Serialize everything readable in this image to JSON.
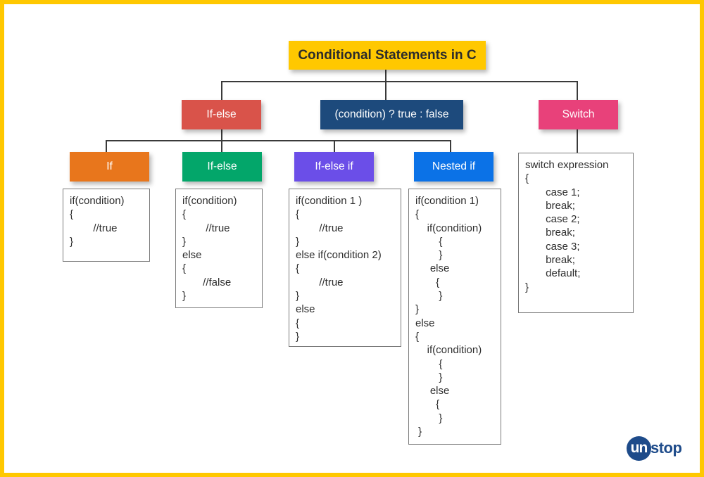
{
  "title": "Conditional Statements in C",
  "colors": {
    "border": "#ffc800",
    "title_bg": "#ffc800",
    "if_else_top": "#d9534a",
    "ternary": "#1d4a7c",
    "switch": "#e8417a",
    "if": "#e8761c",
    "if_else": "#03a66a",
    "if_else_if": "#6b4ee8",
    "nested_if": "#0b72e7"
  },
  "level1": [
    {
      "id": "if-else",
      "label": "If-else"
    },
    {
      "id": "ternary",
      "label": "(condition) ? true : false"
    },
    {
      "id": "switch",
      "label": "Switch"
    }
  ],
  "level2": [
    {
      "id": "if",
      "label": "If"
    },
    {
      "id": "if-else",
      "label": "If-else"
    },
    {
      "id": "if-else-if",
      "label": "If-else if"
    },
    {
      "id": "nested-if",
      "label": "Nested if"
    }
  ],
  "code": {
    "if": [
      "if(condition)",
      "{",
      "        //true",
      "}"
    ],
    "if_else": [
      "if(condition)",
      "{",
      "        //true",
      "}",
      "else",
      "{",
      "       //false",
      "}"
    ],
    "if_else_if": [
      "if(condition 1 )",
      "{",
      "        //true",
      "}",
      "else if(condition 2)",
      "{",
      "        //true",
      "}",
      "else",
      "{",
      "}"
    ],
    "nested_if": [
      "if(condition 1)",
      "{",
      "    if(condition)",
      "        {",
      "        }",
      "     else",
      "       {",
      "        }",
      "}",
      "else",
      "{",
      "    if(condition)",
      "        {",
      "        }",
      "     else",
      "       {",
      "        }",
      " }"
    ],
    "switch": [
      "switch expression",
      "{",
      "       case 1;",
      "       break;",
      "       case 2;",
      "       break;",
      "       case 3;",
      "       break;",
      "       default;",
      "}"
    ]
  },
  "logo": {
    "circle": "un",
    "text": "stop"
  }
}
